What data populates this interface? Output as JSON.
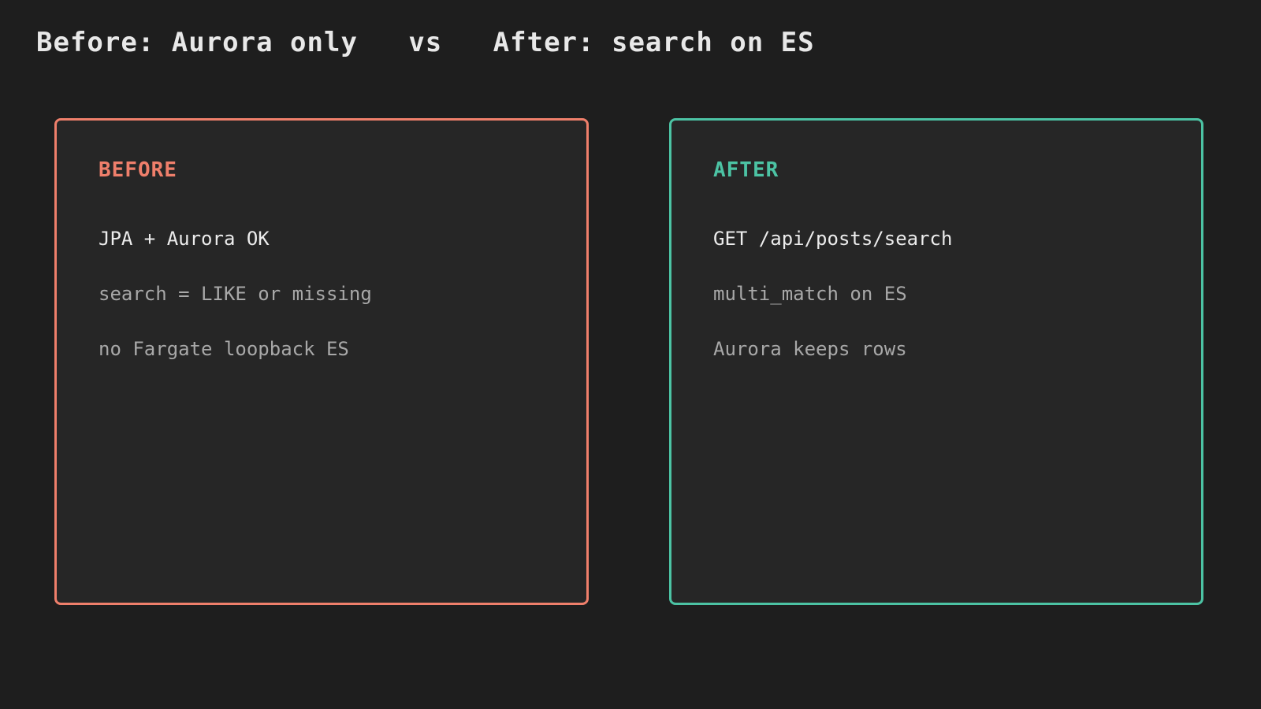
{
  "title": "Before: Aurora only   vs   After: search on ES",
  "colors": {
    "background": "#1e1e1e",
    "panel_background": "#262626",
    "before_accent": "#ef7f6b",
    "after_accent": "#4cc3a4"
  },
  "before": {
    "label": "BEFORE",
    "lines": [
      "JPA + Aurora OK",
      "search = LIKE or missing",
      "no Fargate loopback ES"
    ]
  },
  "after": {
    "label": "AFTER",
    "lines": [
      "GET /api/posts/search",
      "multi_match on ES",
      "Aurora keeps rows"
    ]
  }
}
